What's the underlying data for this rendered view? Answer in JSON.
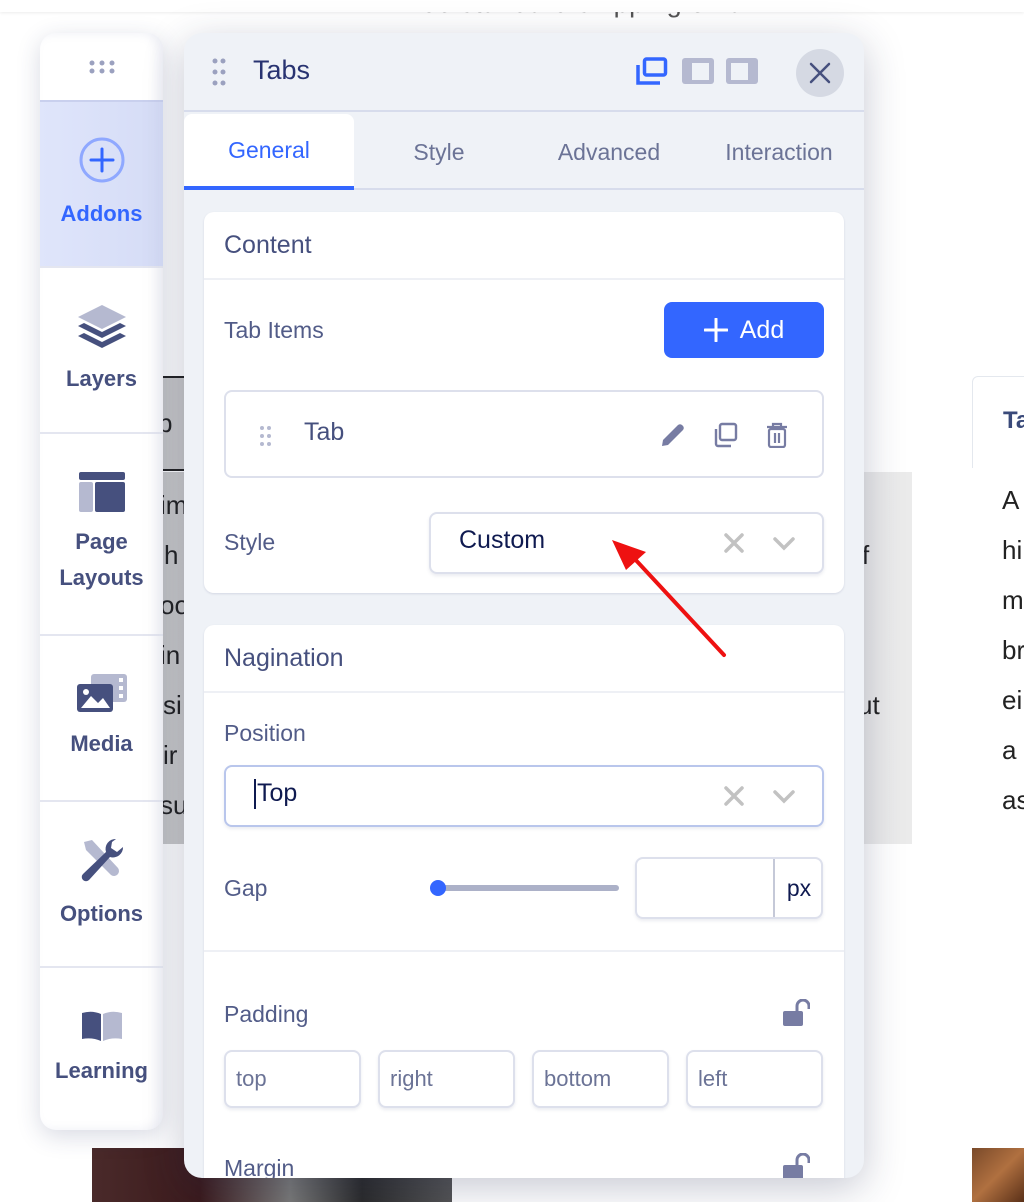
{
  "background_page": {
    "shipping_banner": "Free standard shipping on all",
    "left_tab_fragment": "b",
    "left_text_fragments": [
      "im",
      "h",
      "oo",
      "in",
      "si",
      "ir",
      "su"
    ],
    "right_text_fragments": [
      "f",
      "ut"
    ],
    "right_tab_fragment": "Ta",
    "right_column_fragments": [
      "A",
      "hi",
      "m",
      "br",
      "ei",
      "a",
      "as"
    ]
  },
  "rail": {
    "items": [
      {
        "label": "Addons",
        "icon": "plus-circle-icon",
        "active": true
      },
      {
        "label": "Layers",
        "icon": "layers-icon",
        "active": false
      },
      {
        "label_line1": "Page",
        "label_line2": "Layouts",
        "icon": "page-layout-icon",
        "active": false
      },
      {
        "label": "Media",
        "icon": "media-icon",
        "active": false
      },
      {
        "label": "Options",
        "icon": "tools-icon",
        "active": false
      },
      {
        "label": "Learning",
        "icon": "book-icon",
        "active": false
      }
    ]
  },
  "panel": {
    "title": "Tabs",
    "view_modes": [
      "floating-window-icon",
      "dock-left-icon",
      "dock-right-icon"
    ],
    "active_view_mode": "floating-window-icon",
    "tabs": [
      {
        "label": "General",
        "active": true
      },
      {
        "label": "Style",
        "active": false
      },
      {
        "label": "Advanced",
        "active": false
      },
      {
        "label": "Interaction",
        "active": false
      }
    ],
    "content": {
      "title": "Content",
      "tab_items_label": "Tab Items",
      "add_label": "Add",
      "items": [
        {
          "name": "Tab"
        }
      ],
      "style_label": "Style",
      "style_value": "Custom"
    },
    "nagination": {
      "title": "Nagination",
      "position_label": "Position",
      "position_value": "Top",
      "gap_label": "Gap",
      "gap_value": "",
      "gap_slider_fraction": 0,
      "gap_unit": "px",
      "padding_label": "Padding",
      "padding_placeholders": [
        "top",
        "right",
        "bottom",
        "left"
      ],
      "margin_label": "Margin"
    }
  },
  "colors": {
    "accent": "#3366ff",
    "text_primary": "#283371",
    "text_secondary": "#46507e",
    "annotation_arrow": "#ee1111"
  }
}
